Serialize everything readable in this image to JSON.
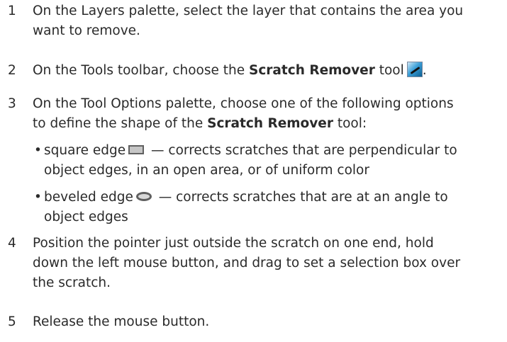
{
  "steps": [
    {
      "number": "1",
      "lines": [
        "On the Layers palette, select the layer that contains the area you",
        "want to remove."
      ]
    },
    {
      "number": "2",
      "prefix": "On the Tools toolbar, choose the ",
      "bold": "Scratch Remover",
      "suffix": " tool",
      "end": ".",
      "icon": "scratch-remover-tool-icon"
    },
    {
      "number": "3",
      "line1": "On the Tool Options palette, choose one of the following options",
      "line2_prefix": "to define the shape of the ",
      "line2_bold": "Scratch Remover",
      "line2_suffix": " tool:",
      "options": [
        {
          "bullet": "•",
          "lead": "square edge",
          "icon": "square-edge-icon",
          "line1_rest": " — corrects scratches that are perpendicular to",
          "line2": "object edges, in an open area, or of uniform color"
        },
        {
          "bullet": "•",
          "lead": "beveled edge",
          "icon": "beveled-edge-icon",
          "line1_rest": " — corrects scratches that are at an angle to",
          "line2": "object edges"
        }
      ]
    },
    {
      "number": "4",
      "lines": [
        "Position the pointer just outside the scratch on one end, hold",
        "down the left mouse button, and drag to set a selection box over",
        "the scratch."
      ]
    },
    {
      "number": "5",
      "lines": [
        "Release the mouse button."
      ]
    }
  ]
}
